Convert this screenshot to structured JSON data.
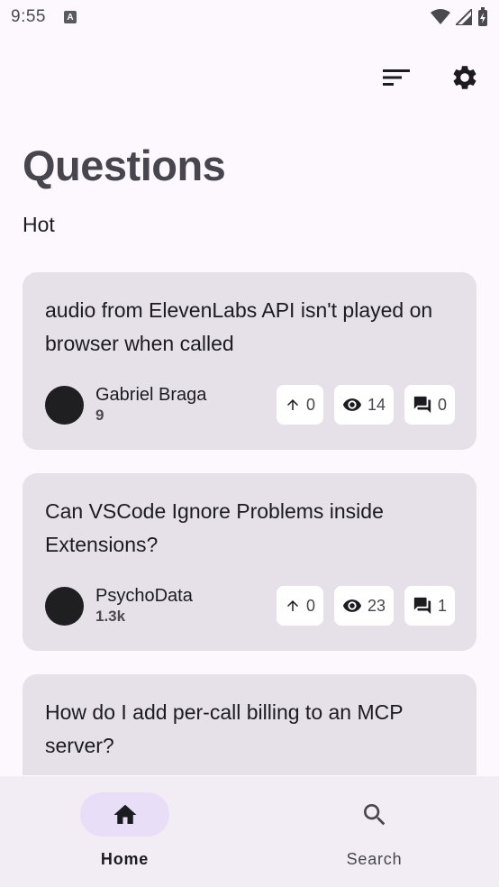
{
  "status_bar": {
    "time": "9:55",
    "notification_letter": "A"
  },
  "header": {
    "title": "Questions",
    "subtitle": "Hot"
  },
  "questions": [
    {
      "title": "audio from ElevenLabs API isn't played on browser when called",
      "author": "Gabriel Braga",
      "reputation": "9",
      "votes": "0",
      "views": "14",
      "answers": "0"
    },
    {
      "title": "Can VSCode Ignore Problems inside Extensions?",
      "author": "PsychoData",
      "reputation": "1.3k",
      "votes": "0",
      "views": "23",
      "answers": "1"
    },
    {
      "title": "How do I add per-call billing to an MCP server?",
      "author": "",
      "reputation": "",
      "votes": "",
      "views": "",
      "answers": ""
    }
  ],
  "bottom_nav": {
    "home_label": "Home",
    "search_label": "Search"
  },
  "colors": {
    "background": "#fdf8fd",
    "card": "#e6e0e9",
    "nav_active": "#e8def8",
    "nav_bar": "#f2ecf4"
  }
}
